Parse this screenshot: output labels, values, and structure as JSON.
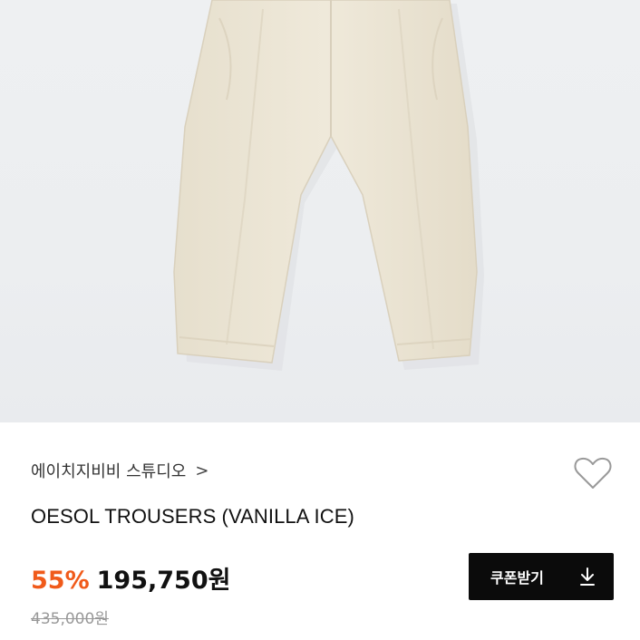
{
  "product": {
    "brand": "에이치지비비 스튜디오",
    "brand_chevron": ">",
    "name": "OESOL TROUSERS (VANILLA ICE)",
    "discount": "55%",
    "sale_price": "195,750원",
    "original_price": "435,000원"
  },
  "actions": {
    "coupon_label": "쿠폰받기",
    "wishlist_icon": "heart-outline-icon",
    "download_icon": "download-icon"
  },
  "colors": {
    "discount": "#f05a1a",
    "button_bg": "#0b0b0b",
    "trousers": "#ede6d6",
    "background": "#eceef0"
  }
}
